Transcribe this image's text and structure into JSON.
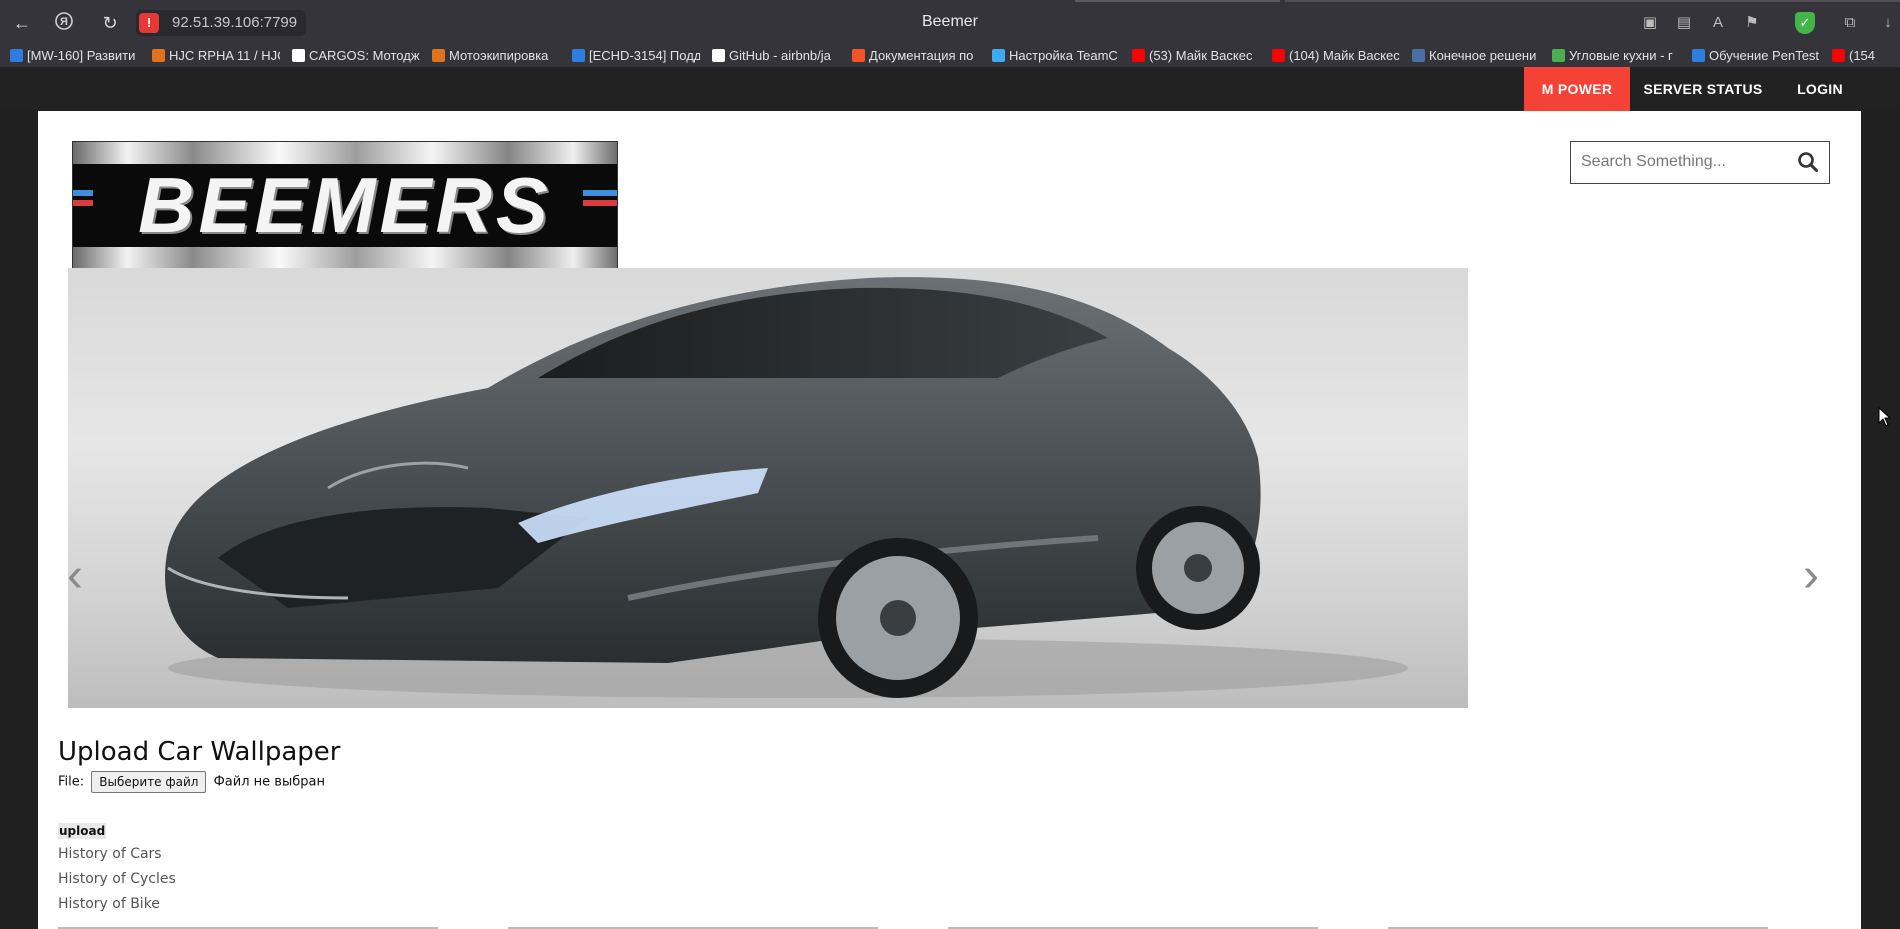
{
  "browser": {
    "url": "92.51.39.106:7799",
    "window_title": "Beemer",
    "bookmarks": [
      {
        "label": "[MW-160] Развити",
        "icon_color": "#2f7de1"
      },
      {
        "label": "HJC RPHA 11 / HJC",
        "icon_color": "#e0731d"
      },
      {
        "label": "CARGOS: Мотодж",
        "icon_color": "#ffffff"
      },
      {
        "label": "Мотоэкипировка",
        "icon_color": "#e0731d"
      },
      {
        "label": "[ECHD-3154] Подд",
        "icon_color": "#2f7de1"
      },
      {
        "label": "GitHub - airbnb/ja",
        "icon_color": "#ffffff"
      },
      {
        "label": "Документация по",
        "icon_color": "#f35325"
      },
      {
        "label": "Настройка TeamC",
        "icon_color": "#3fa9f5"
      },
      {
        "label": "(53) Майк Васкес",
        "icon_color": "#ff0000"
      },
      {
        "label": "(104) Майк Васкес",
        "icon_color": "#ff0000"
      },
      {
        "label": "Конечное решени",
        "icon_color": "#4a6fa5"
      },
      {
        "label": "Угловые кухни - г",
        "icon_color": "#4caf50"
      },
      {
        "label": "Обучение PenTest",
        "icon_color": "#2f7de1"
      },
      {
        "label": "(154",
        "icon_color": "#ff0000"
      }
    ]
  },
  "nav": {
    "items": [
      {
        "label": "M POWER",
        "active": true
      },
      {
        "label": "SERVER STATUS",
        "active": false
      },
      {
        "label": "LOGIN",
        "active": false
      }
    ]
  },
  "logo": {
    "text": "BEEMERS"
  },
  "search": {
    "placeholder": "Search Something..."
  },
  "upload": {
    "title": "Upload Car Wallpaper",
    "file_label": "File:",
    "choose_button": "Выберите файл",
    "no_file_text": "Файл не выбран",
    "submit_label": "upload"
  },
  "links": [
    "History of Cars",
    "History of Cycles",
    "History of Bike"
  ],
  "colors": {
    "nav_active": "#f44336",
    "nav_bg": "#222222",
    "page_bg": "#ffffff",
    "outer_bg": "#202020"
  }
}
